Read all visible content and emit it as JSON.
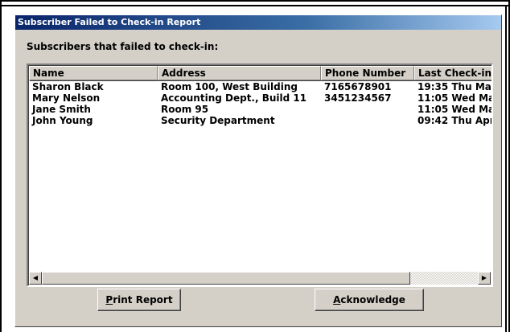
{
  "window": {
    "title": "Subscriber Failed to Check-in Report"
  },
  "group_label": "Subscribers that failed to check-in:",
  "table": {
    "columns": [
      "Name",
      "Address",
      "Phone Number",
      "Last Check-in"
    ],
    "rows": [
      [
        "Sharon Black",
        "Room 100, West Building",
        "7165678901",
        "19:35 Thu Mar"
      ],
      [
        "Mary Nelson",
        "Accounting Dept., Build 11",
        "3451234567",
        "11:05 Wed Ma"
      ],
      [
        "Jane Smith",
        "Room 95",
        "",
        "11:05 Wed Ma"
      ],
      [
        "John Young",
        "Security Department",
        "",
        "09:42 Thu Apr"
      ]
    ]
  },
  "scrollbar": {
    "left_arrow": "◀",
    "right_arrow": "▶"
  },
  "buttons": {
    "print_mnemonic": "P",
    "print_rest": "rint Report",
    "ack_mnemonic": "A",
    "ack_rest": "cknowledge"
  }
}
